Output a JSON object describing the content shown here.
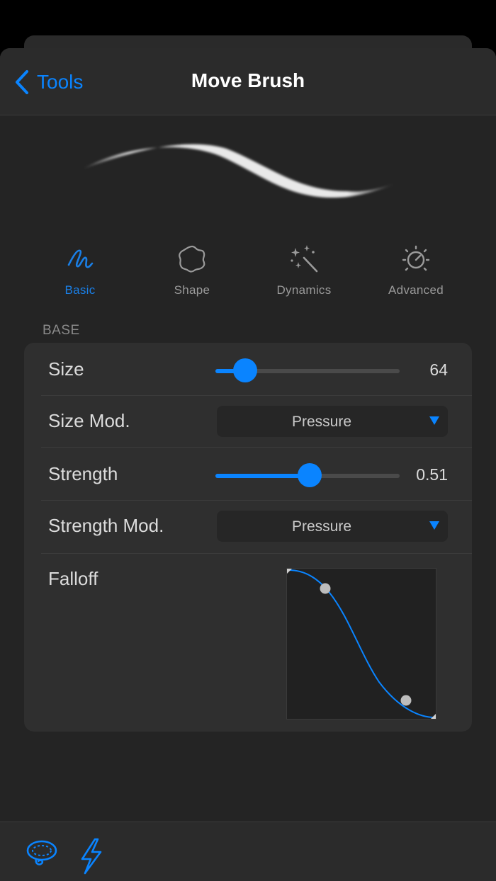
{
  "nav": {
    "back_label": "Tools",
    "title": "Move Brush"
  },
  "tabs": [
    {
      "label": "Basic",
      "icon": "squiggle-icon",
      "active": true
    },
    {
      "label": "Shape",
      "icon": "shape-blob-icon",
      "active": false
    },
    {
      "label": "Dynamics",
      "icon": "magic-wand-icon",
      "active": false
    },
    {
      "label": "Advanced",
      "icon": "dial-icon",
      "active": false
    }
  ],
  "base": {
    "header": "BASE",
    "size": {
      "label": "Size",
      "value": "64",
      "fraction": 0.16
    },
    "size_mod": {
      "label": "Size Mod.",
      "selected": "Pressure"
    },
    "strength": {
      "label": "Strength",
      "value": "0.51",
      "fraction": 0.51
    },
    "strength_mod": {
      "label": "Strength Mod.",
      "selected": "Pressure"
    },
    "falloff": {
      "label": "Falloff"
    }
  },
  "colors": {
    "accent": "#0a84ff",
    "background": "#242424",
    "card": "#2f2f2f"
  },
  "bottom_bar": {
    "icons": [
      "lasso-icon",
      "lightning-icon"
    ]
  }
}
